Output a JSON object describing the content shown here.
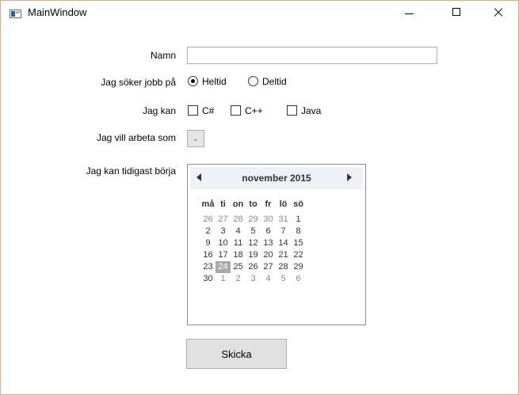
{
  "window": {
    "title": "MainWindow",
    "accent_border": "#e8a87c"
  },
  "form": {
    "name_label": "Namn",
    "name_value": "",
    "job_label": "Jag söker jobb på",
    "job_options": [
      {
        "label": "Heltid",
        "checked": true
      },
      {
        "label": "Deltid",
        "checked": false
      }
    ],
    "skills_label": "Jag kan",
    "skills": [
      {
        "label": "C#",
        "checked": false
      },
      {
        "label": "C++",
        "checked": false
      },
      {
        "label": "Java",
        "checked": false
      }
    ],
    "role_label": "Jag vill arbeta som",
    "role_value": "",
    "start_label": "Jag kan tidigast börja",
    "submit_label": "Skicka"
  },
  "calendar": {
    "month_title": "november 2015",
    "weekdays": [
      "må",
      "ti",
      "on",
      "to",
      "fr",
      "lö",
      "sö"
    ],
    "weeks": [
      [
        "26",
        "27",
        "28",
        "29",
        "30",
        "31",
        "1"
      ],
      [
        "2",
        "3",
        "4",
        "5",
        "6",
        "7",
        "8"
      ],
      [
        "9",
        "10",
        "11",
        "12",
        "13",
        "14",
        "15"
      ],
      [
        "16",
        "17",
        "18",
        "19",
        "20",
        "21",
        "22"
      ],
      [
        "23",
        "24",
        "25",
        "26",
        "27",
        "28",
        "29"
      ],
      [
        "30",
        "1",
        "2",
        "3",
        "4",
        "5",
        "6"
      ]
    ],
    "today": "24",
    "header_bg": "#eef1f6",
    "today_bg": "#a9a9a9"
  }
}
